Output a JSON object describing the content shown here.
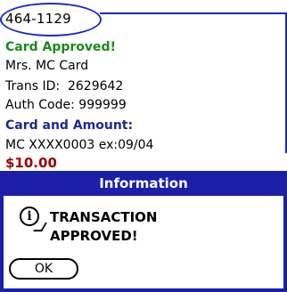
{
  "header": {
    "phone": "464-1129"
  },
  "receipt": {
    "status": "Card Approved!",
    "name": "Mrs. MC Card",
    "trans_id_label": "Trans ID:",
    "trans_id": "2629642",
    "auth_code_label": "Auth Code:",
    "auth_code": "999999",
    "section_label": "Card and Amount:",
    "card_masked": "MC XXXX0003 ex:09/04",
    "amount": "$10.00"
  },
  "dialog": {
    "title": "Information",
    "message_line1": "TRANSACTION",
    "message_line2": "APPROVED!",
    "ok_label": "OK",
    "icon": "info-icon"
  },
  "colors": {
    "accent_blue": "#1c1faa",
    "approved_green": "#1a8a1a",
    "amount_red": "#9b0000",
    "heading_blue": "#1a2b8f"
  }
}
